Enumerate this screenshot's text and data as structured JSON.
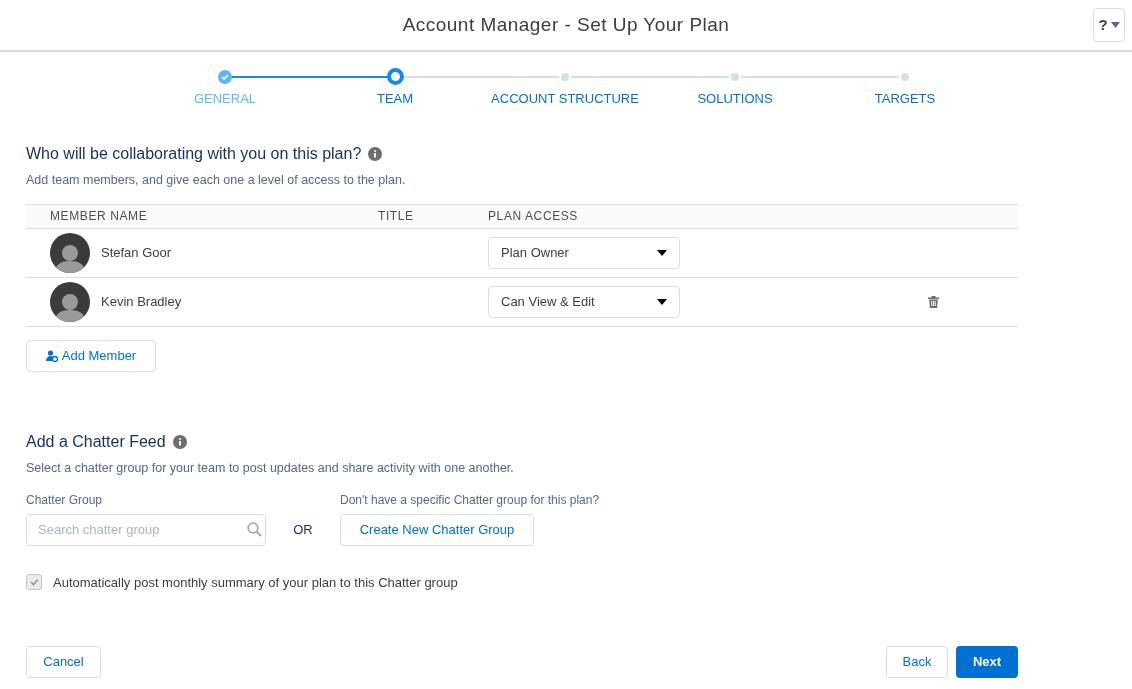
{
  "header": {
    "title": "Account Manager - Set Up Your Plan",
    "help_button": "?"
  },
  "steps": [
    {
      "label": "GENERAL",
      "completed": true,
      "selected": false
    },
    {
      "label": "TEAM",
      "completed": false,
      "selected": true
    },
    {
      "label": "ACCOUNT STRUCTURE",
      "completed": false,
      "selected": false
    },
    {
      "label": "SOLUTIONS",
      "completed": false,
      "selected": false
    },
    {
      "label": "TARGETS",
      "completed": false,
      "selected": false
    }
  ],
  "team_section": {
    "heading": "Who will be collaborating with you on this plan?",
    "description": "Add team members, and give each one a level of access to the plan.",
    "table": {
      "columns": [
        "MEMBER NAME",
        "TITLE",
        "PLAN ACCESS"
      ],
      "rows": [
        {
          "name": "Stefan Goor",
          "access": "Plan Owner",
          "deletable": false
        },
        {
          "name": "Kevin Bradley",
          "access": "Can View & Edit",
          "deletable": true
        }
      ]
    },
    "add_button": "Add Member"
  },
  "chatter_section": {
    "heading": "Add a Chatter Feed",
    "description": "Select a chatter group for your team to post updates and share activity with one another.",
    "group_label": "Chatter Group",
    "search_placeholder": "Search chatter group",
    "or_text": "OR",
    "create_hint": "Don't have a specific Chatter group for this plan?",
    "create_button": "Create New Chatter Group",
    "auto_post": {
      "label": "Automatically post monthly summary of your plan to this Chatter group",
      "checked": true
    }
  },
  "footer": {
    "cancel": "Cancel",
    "back": "Back",
    "next": "Next"
  }
}
